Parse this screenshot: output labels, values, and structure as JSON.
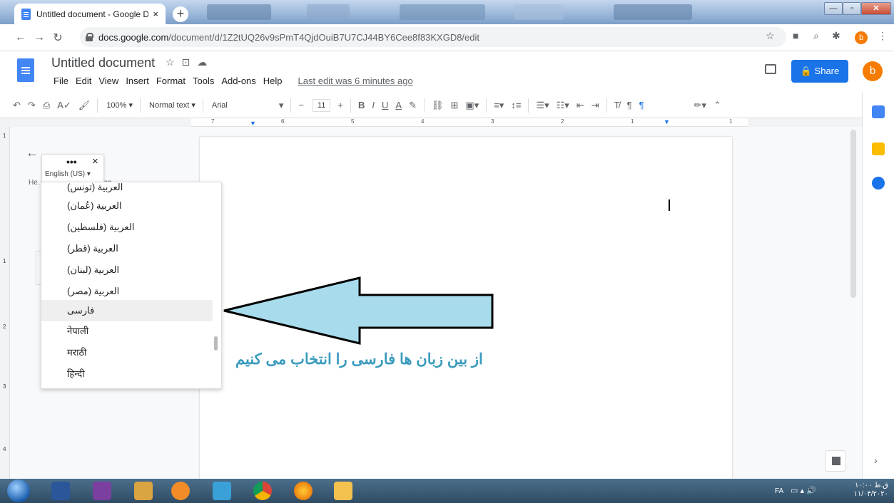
{
  "browser": {
    "tab_title": "Untitled document - Google Doc",
    "tab_close": "×",
    "newtab": "+",
    "url_host": "docs.google.com",
    "url_path": "/document/d/1Z2tUQ26v9sPmT4QjdOuiB7U7CJ44BY6Cee8f83KXGD8/edit",
    "profile_initial": "b"
  },
  "docs": {
    "title": "Untitled document",
    "menu": [
      "File",
      "Edit",
      "View",
      "Insert",
      "Format",
      "Tools",
      "Add-ons",
      "Help"
    ],
    "last_edit": "Last edit was 6 minutes ago",
    "share_label": "Share",
    "avatar_initial": "b"
  },
  "toolbar": {
    "zoom": "100%",
    "style": "Normal text",
    "font": "Arial",
    "font_size": "11"
  },
  "ruler": {
    "ticks": [
      "7",
      "6",
      "5",
      "4",
      "3",
      "2",
      "1",
      "1"
    ]
  },
  "vruler": {
    "ticks": [
      "1",
      "1",
      "2",
      "3",
      "4"
    ]
  },
  "outline": {
    "text": "He… the document will ap…"
  },
  "popup": {
    "dots": "•••",
    "close": "×",
    "language": "English (US) ▾"
  },
  "dropdown": {
    "items": [
      "العربية (تونس)",
      "العربية (عُمان)",
      "العربية (فلسطين)",
      "العربية (قطر)",
      "العربية (لبنان)",
      "العربية (مصر)",
      "فارسی",
      "नेपाली",
      "मराठी",
      "हिन्दी"
    ],
    "selected_index": 6
  },
  "annotation": {
    "caption": "از بین زبان ها فارسی را انتخاب می کنیم",
    "arrow_color": "#a8dcec"
  },
  "taskbar": {
    "lang": "FA",
    "time": "۱۰:۰۰ ق.ظ",
    "date": "۱۱/۰۴/۲۰۲۰"
  }
}
